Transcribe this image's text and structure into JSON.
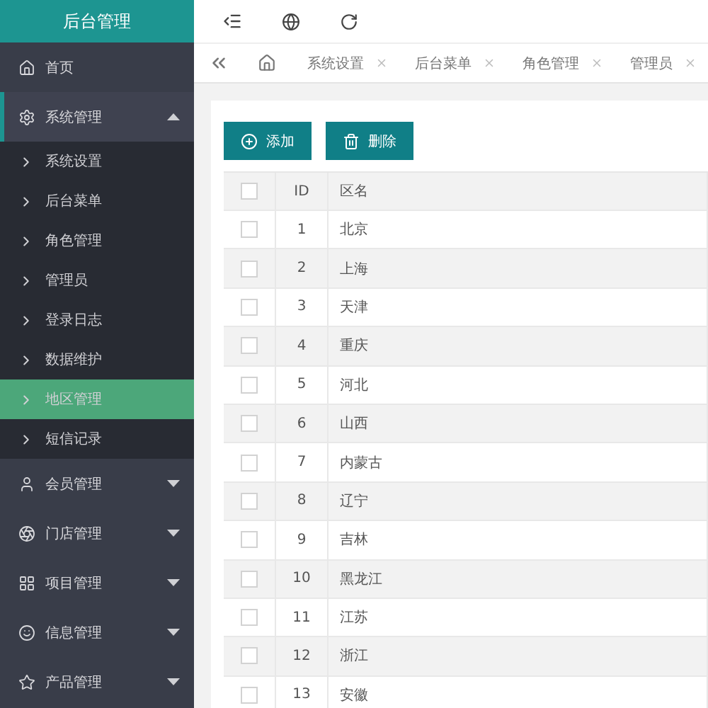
{
  "brand": "后台管理",
  "sidebar": {
    "items": [
      {
        "label": "首页",
        "kind": "link",
        "selected": false
      },
      {
        "label": "系统管理",
        "kind": "group",
        "expanded": true,
        "selected": true,
        "children": [
          {
            "label": "系统设置",
            "selected": false
          },
          {
            "label": "后台菜单",
            "selected": false
          },
          {
            "label": "角色管理",
            "selected": false
          },
          {
            "label": "管理员",
            "selected": false
          },
          {
            "label": "登录日志",
            "selected": false
          },
          {
            "label": "数据维护",
            "selected": false
          },
          {
            "label": "地区管理",
            "selected": true
          },
          {
            "label": "短信记录",
            "selected": false
          }
        ]
      },
      {
        "label": "会员管理",
        "kind": "group",
        "expanded": false,
        "selected": false
      },
      {
        "label": "门店管理",
        "kind": "group",
        "expanded": false,
        "selected": false
      },
      {
        "label": "项目管理",
        "kind": "group",
        "expanded": false,
        "selected": false
      },
      {
        "label": "信息管理",
        "kind": "group",
        "expanded": false,
        "selected": false
      },
      {
        "label": "产品管理",
        "kind": "group",
        "expanded": false,
        "selected": false
      }
    ]
  },
  "tabs": [
    {
      "label": "系统设置",
      "selected": false
    },
    {
      "label": "后台菜单",
      "selected": false
    },
    {
      "label": "角色管理",
      "selected": false
    },
    {
      "label": "管理员",
      "selected": false
    }
  ],
  "buttons": [
    {
      "label": "添加",
      "kind": "add"
    },
    {
      "label": "删除",
      "kind": "delete"
    }
  ],
  "table": {
    "select_all": {
      "checked": false
    },
    "columns": [
      "ID",
      "区名"
    ],
    "rows": [
      {
        "id": "1",
        "name": "北京",
        "checked": false
      },
      {
        "id": "2",
        "name": "上海",
        "checked": false
      },
      {
        "id": "3",
        "name": "天津",
        "checked": false
      },
      {
        "id": "4",
        "name": "重庆",
        "checked": false
      },
      {
        "id": "5",
        "name": "河北",
        "checked": false
      },
      {
        "id": "6",
        "name": "山西",
        "checked": false
      },
      {
        "id": "7",
        "name": "内蒙古",
        "checked": false
      },
      {
        "id": "8",
        "name": "辽宁",
        "checked": false
      },
      {
        "id": "9",
        "name": "吉林",
        "checked": false
      },
      {
        "id": "10",
        "name": "黑龙江",
        "checked": false
      },
      {
        "id": "11",
        "name": "江苏",
        "checked": false
      },
      {
        "id": "12",
        "name": "浙江",
        "checked": false
      },
      {
        "id": "13",
        "name": "安徽",
        "checked": false
      }
    ]
  }
}
